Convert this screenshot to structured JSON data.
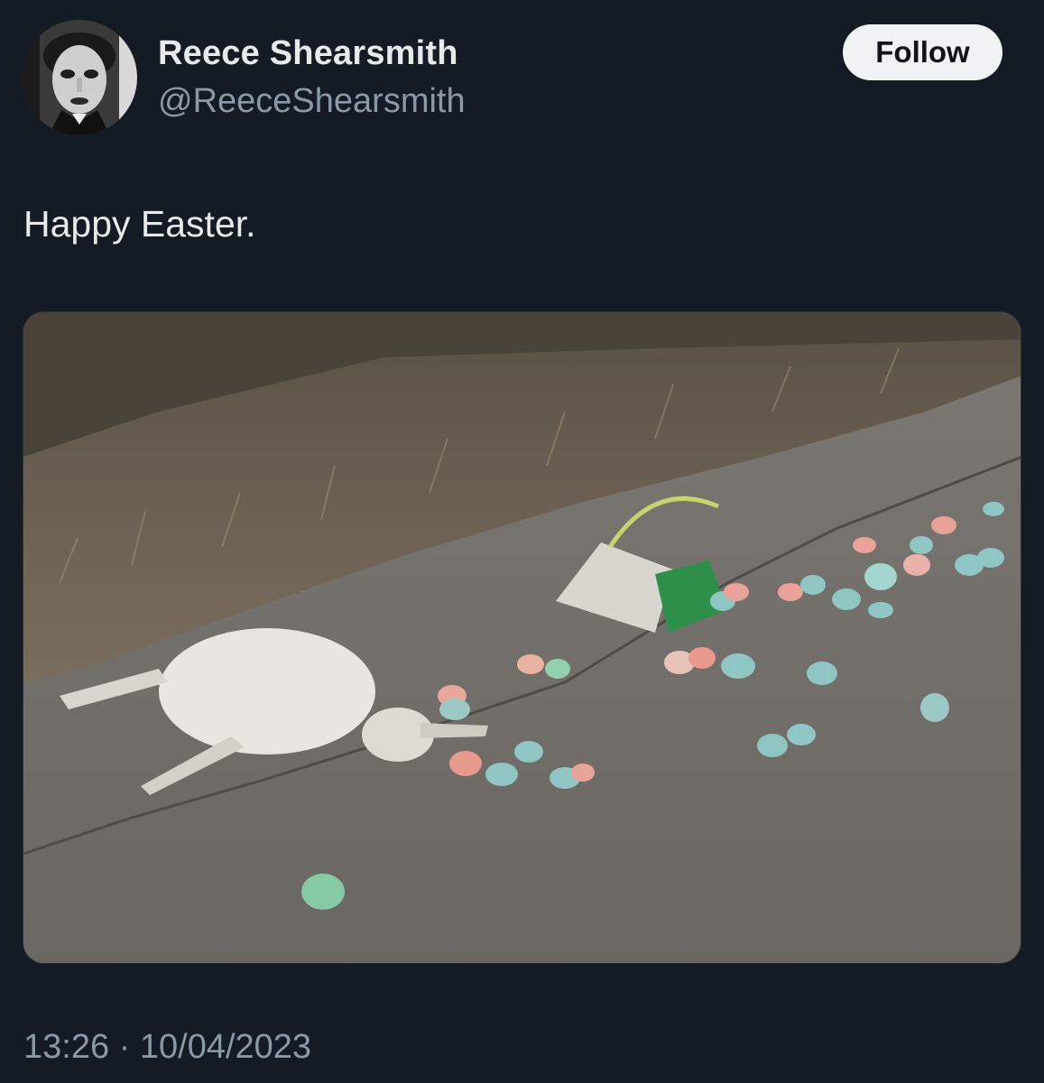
{
  "author": {
    "display_name": "Reece Shearsmith",
    "handle": "@ReeceShearsmith"
  },
  "follow_button": {
    "label": "Follow"
  },
  "tweet": {
    "text": "Happy Easter.",
    "timestamp": "13:26 · 10/04/2023"
  },
  "colors": {
    "background": "#141b24",
    "primary_text": "#e7e9ea",
    "secondary_text": "#8b98a5",
    "follow_button_bg": "#eff3f4"
  }
}
